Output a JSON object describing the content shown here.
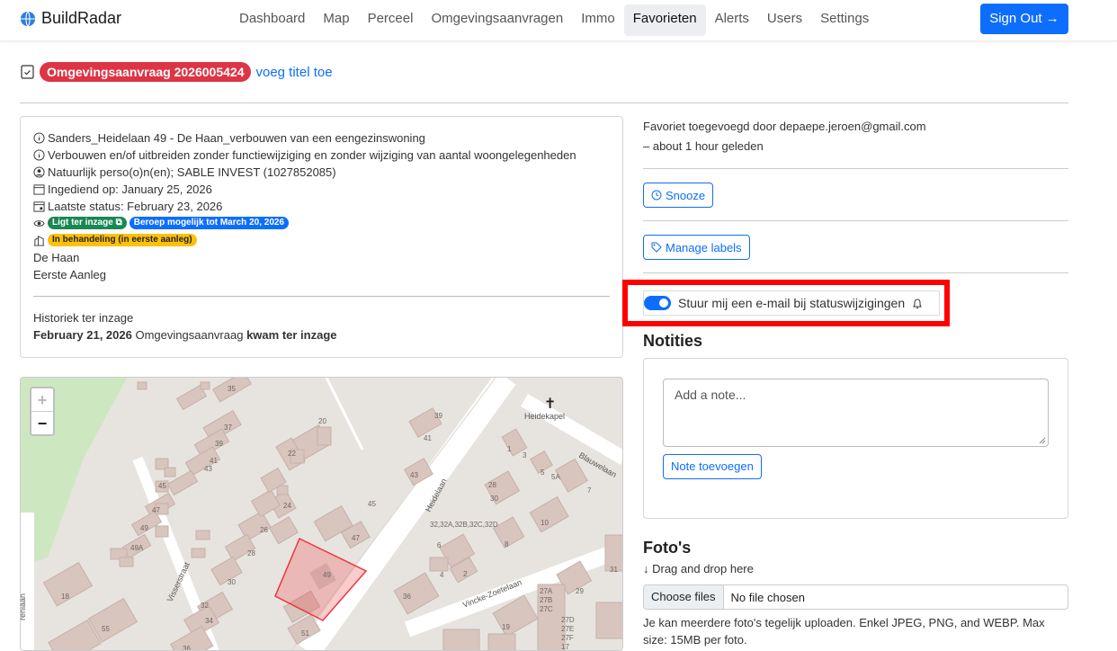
{
  "nav": {
    "brand": "BuildRadar",
    "links": [
      "Dashboard",
      "Map",
      "Perceel",
      "Omgevingsaanvragen",
      "Immo",
      "Favorieten",
      "Alerts",
      "Users",
      "Settings"
    ],
    "active": "Favorieten",
    "sign_out": "Sign Out →"
  },
  "title": {
    "application_id": "Omgevingsaanvraag 2026005424",
    "add_title_link": "voeg titel toe"
  },
  "details": {
    "project": "Sanders_Heidelaan 49 - De Haan_verbouwen van een eengezinswoning",
    "work_type": "Verbouwen en/of uitbreiden zonder functiewijziging en zonder wijziging van aantal woongelegenheden",
    "applicant": "Natuurlijk perso(o)n(en); SABLE INVEST (1027852085)",
    "submitted": "Ingediend op: January 25, 2026",
    "last_status": "Laatste status: February 23, 2026",
    "badge_inspection": "Ligt ter inzage",
    "badge_appeal": "Beroep mogelijk tot March 20, 2026",
    "badge_status": "In behandeling (in eerste aanleg)",
    "municipality": "De Haan",
    "instance": "Eerste Aanleg",
    "history_label": "Historiek ter inzage",
    "history_date": "February 21, 2026",
    "history_mid": "Omgevingsaanvraag",
    "history_event": "kwam ter inzage"
  },
  "sidebar": {
    "favorited_by": "Favoriet toegevoegd door depaepe.jeroen@gmail.com",
    "favorited_when": "– about 1 hour geleden",
    "snooze": "Snooze",
    "manage_labels": "Manage labels",
    "email_toggle_label": "Stuur mij een e-mail bij statuswijzigingen",
    "email_toggle_on": true
  },
  "notes": {
    "heading": "Notities",
    "placeholder": "Add a note...",
    "add_button": "Note toevoegen"
  },
  "photos": {
    "heading": "Foto's",
    "drag_drop": "↓ Drag and drop here",
    "choose_files": "Choose files",
    "no_file": "No file chosen",
    "help": "Je kan meerdere foto's tegelijk uploaden. Enkel JPEG, PNG, and WEBP. Max size: 15MB per foto."
  },
  "map": {
    "zoom_in": "+",
    "zoom_out": "−",
    "street_labels": [
      "Heidelaan",
      "Blauwelaan",
      "Vincke-Zoetelaan",
      "Visserstraat",
      "renlaan"
    ],
    "poi": "Heidekapel",
    "house_numbers": [
      "35",
      "37",
      "39",
      "41",
      "43",
      "45",
      "47",
      "49",
      "49A",
      "20",
      "22",
      "24",
      "26",
      "28",
      "30",
      "32",
      "34",
      "36",
      "18",
      "55",
      "51",
      "1",
      "3",
      "5",
      "5A",
      "7",
      "28",
      "30",
      "10",
      "8",
      "6",
      "2",
      "4",
      "36",
      "29",
      "27A",
      "27B",
      "27C",
      "27D",
      "27E",
      "27F",
      "17",
      "19",
      "21",
      "32,32A,32B,32C,32D",
      "39",
      "41",
      "43",
      "45",
      "47",
      "49",
      "31"
    ],
    "colors": {
      "land": "#e7e4e0",
      "building": "#d7c5be",
      "park": "#cde8c1",
      "road": "#ffffff",
      "highlight": "#f0323c"
    }
  }
}
